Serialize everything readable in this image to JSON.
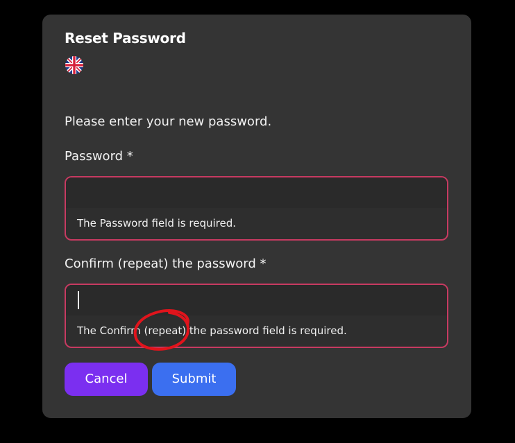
{
  "dialog": {
    "title": "Reset Password",
    "language_flag": "uk-flag-icon",
    "intro": "Please enter your new password.",
    "password": {
      "label": "Password *",
      "value": "",
      "error": "The Password field is required."
    },
    "confirm": {
      "label": "Confirm (repeat) the password *",
      "value": "",
      "error": "The Confirm (repeat) the password field is required."
    },
    "buttons": {
      "cancel": "Cancel",
      "submit": "Submit"
    }
  },
  "colors": {
    "background": "#000000",
    "dialog": "#343434",
    "error_border": "#c73a61",
    "cancel": "#7b2ff0",
    "submit": "#3b6ff0",
    "annotation": "#e0141c"
  }
}
